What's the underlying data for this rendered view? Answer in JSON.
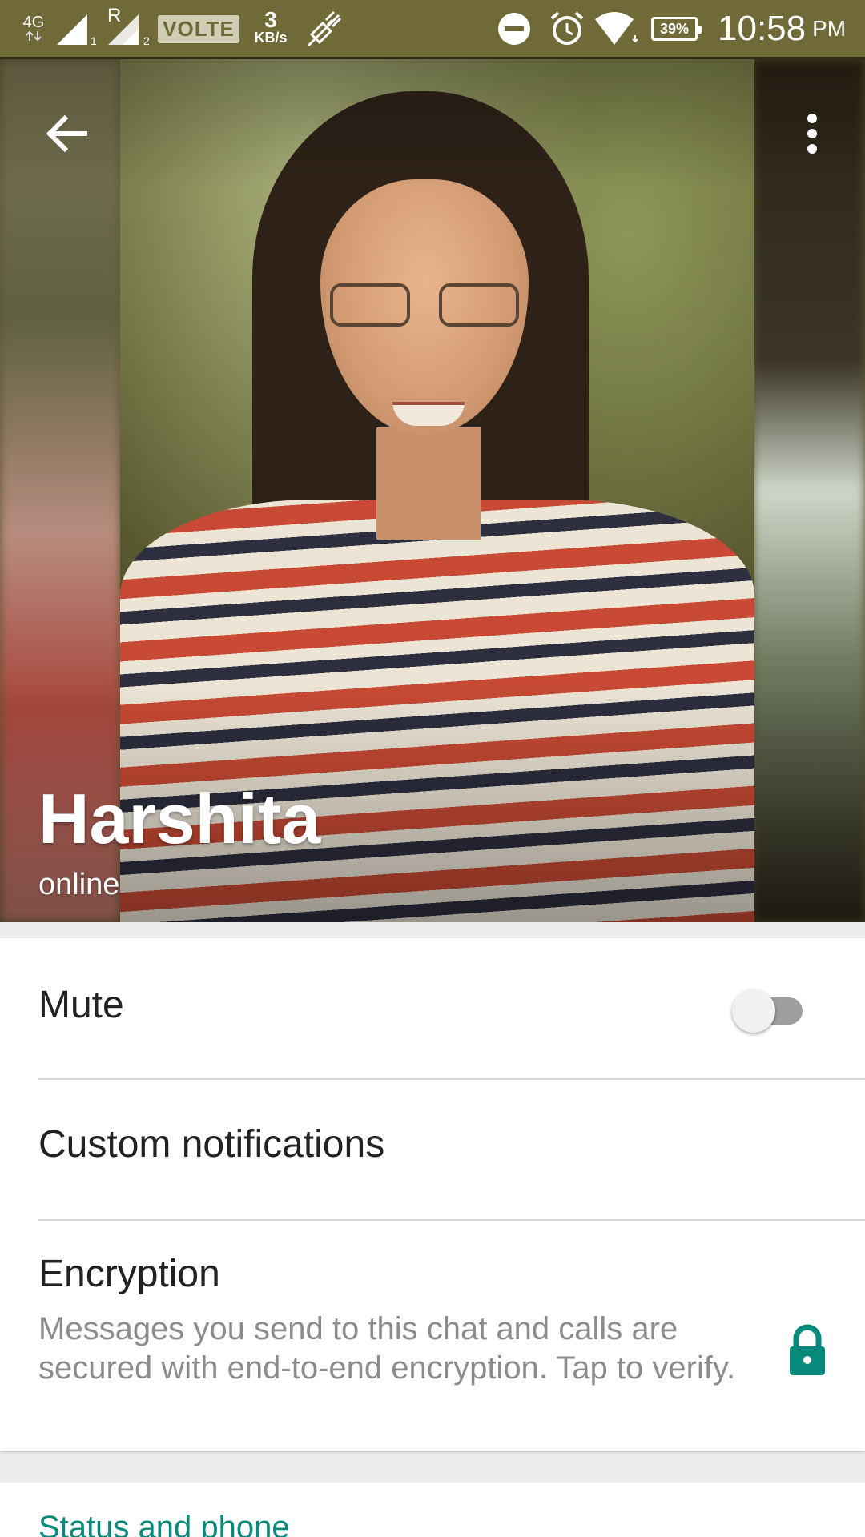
{
  "status_bar": {
    "network": "4G",
    "sim1_label": "R",
    "volte": "VOLTE",
    "speed_value": "3",
    "speed_unit": "KB/s",
    "battery": "39%",
    "time": "10:58",
    "ampm": "PM",
    "icons": [
      "data-arrows-icon",
      "signal-sim1-icon",
      "signal-sim2-icon",
      "satellite-icon",
      "dnd-icon",
      "alarm-icon",
      "wifi-icon",
      "battery-icon"
    ]
  },
  "header": {
    "back_icon": "back-arrow-icon",
    "menu_icon": "more-vert-icon",
    "name": "Harshita",
    "status": "online"
  },
  "settings": {
    "mute": {
      "label": "Mute",
      "enabled": false
    },
    "custom_notifications": {
      "label": "Custom notifications"
    },
    "encryption": {
      "label": "Encryption",
      "description": "Messages you send to this chat and calls are secured with end-to-end encryption. Tap to verify.",
      "icon": "lock-icon"
    }
  },
  "next_section": {
    "title": "Status and phone"
  },
  "colors": {
    "status_bar_bg": "#6f6a38",
    "accent": "#07897b",
    "toggle_off_track": "#9e9e9e",
    "toggle_off_thumb": "#f1f1f1",
    "secondary_text": "#8c8c8c"
  }
}
